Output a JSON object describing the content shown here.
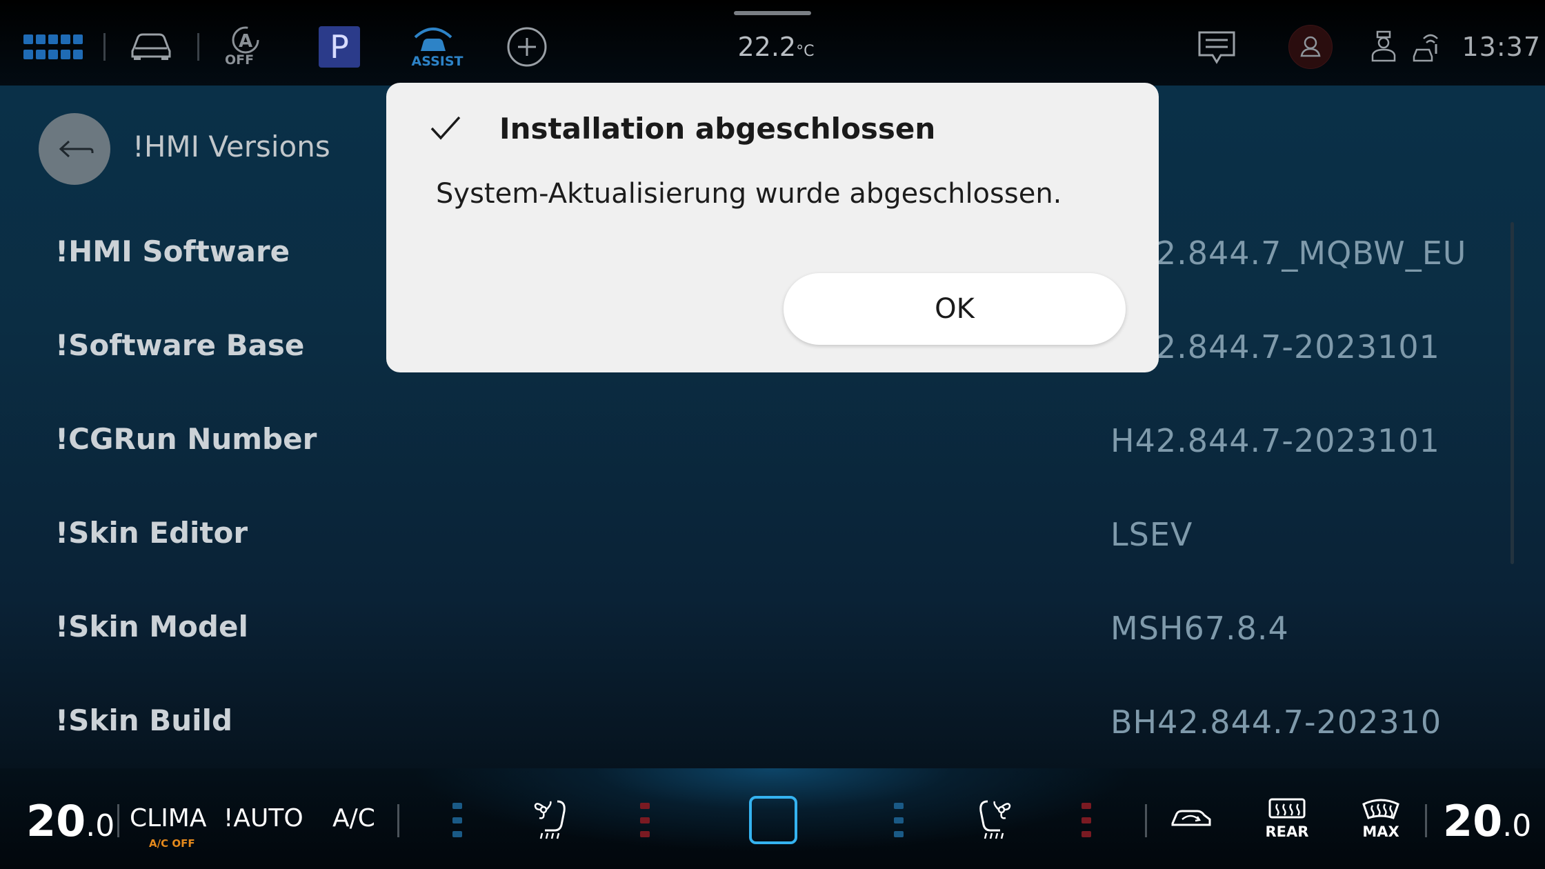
{
  "status_bar": {
    "icons": [
      "apps-grid-icon",
      "car-icon",
      "auto-hold-off-icon",
      "parking-icon",
      "assist-icon",
      "add-icon",
      "message-icon",
      "user-icon",
      "driver-profile-icon",
      "connectivity-icon"
    ],
    "auto_hold_label": "OFF",
    "parking_label": "P",
    "assist_label": "ASSIST",
    "outside_temp": "22.2",
    "temp_unit": "°C",
    "clock": "13:37",
    "colors": {
      "accent_blue": "#1f6bb5",
      "parking_bg": "#2b3b8a"
    }
  },
  "page": {
    "title": "!HMI Versions",
    "rows": [
      {
        "label": "!HMI Software",
        "value": "H42.844.7_MQBW_EU"
      },
      {
        "label": "!Software Base",
        "value": "H42.844.7-2023101"
      },
      {
        "label": "!CGRun Number",
        "value": "H42.844.7-2023101"
      },
      {
        "label": "!Skin Editor",
        "value": "LSEV"
      },
      {
        "label": "!Skin Model",
        "value": "MSH67.8.4"
      },
      {
        "label": "!Skin Build",
        "value": "BH42.844.7-202310"
      }
    ]
  },
  "dialog": {
    "title": "Installation abgeschlossen",
    "message": "System-Aktualisierung wurde abgeschlossen.",
    "ok_label": "OK",
    "icon": "checkmark-icon"
  },
  "climate": {
    "left_temp_int": "20",
    "left_temp_dec": ".0",
    "clima_label": "CLIMA",
    "ac_off_label": "A/C OFF",
    "auto_label": "!AUTO",
    "ac_label": "A/C",
    "rear_label": "REAR",
    "max_label": "MAX",
    "right_temp_int": "20",
    "right_temp_dec": ".0",
    "left_seat_heat_level": 0,
    "right_seat_heat_level": 0,
    "colors": {
      "level_blue": "#1a5a86",
      "level_red": "#7a1a22",
      "center_accent": "#35b3f0",
      "ac_off": "#e58a1c"
    }
  }
}
